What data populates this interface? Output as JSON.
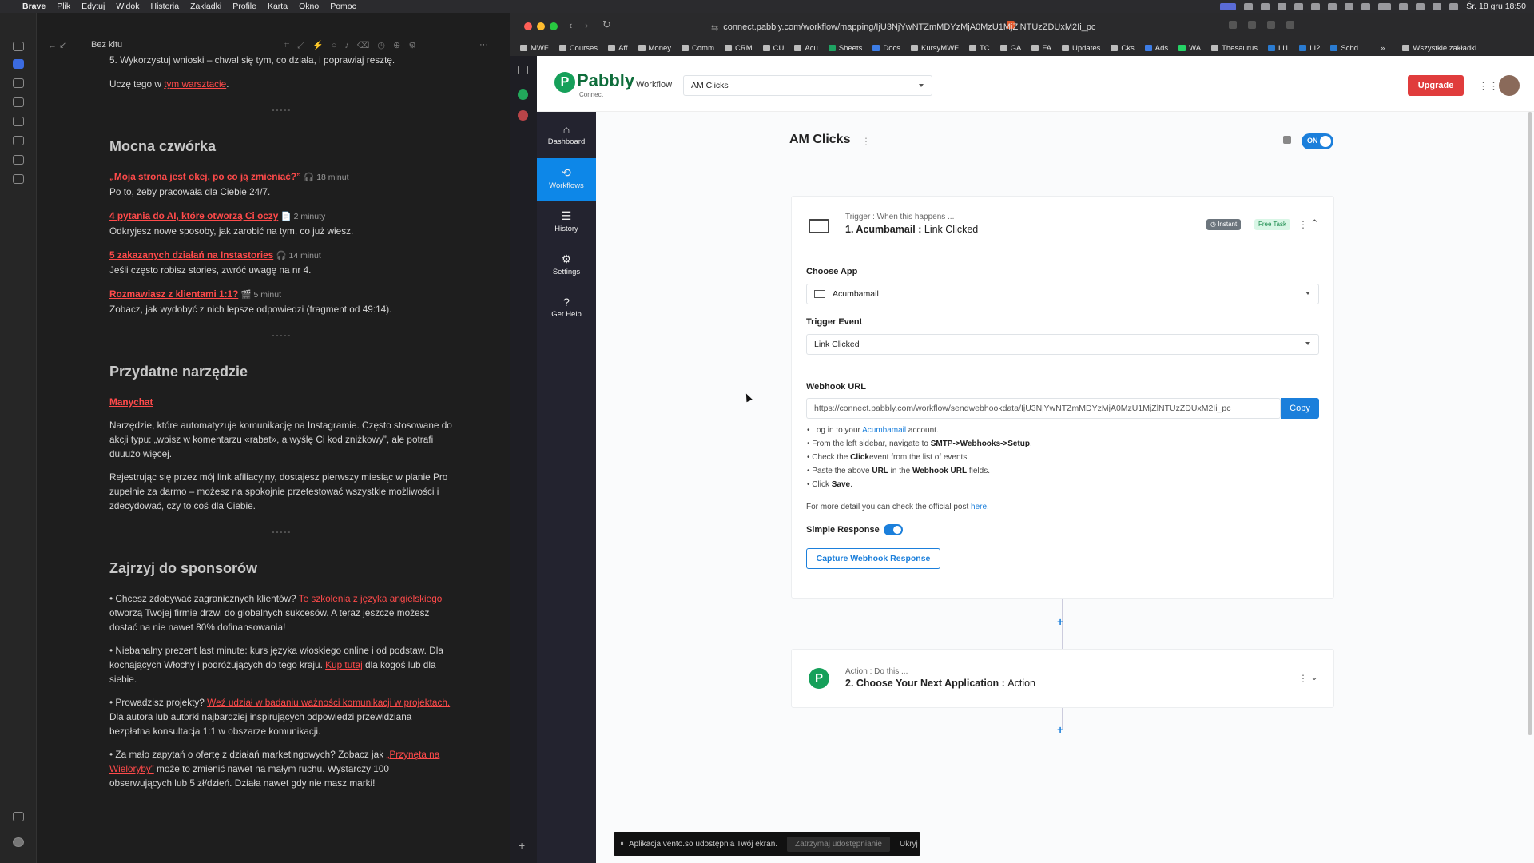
{
  "menubar": {
    "app": "Brave",
    "menus": [
      "Plik",
      "Edytuj",
      "Widok",
      "Historia",
      "Zakładki",
      "Profile",
      "Karta",
      "Okno",
      "Pomoc"
    ],
    "datetime": "Śr. 18 gru  18:50"
  },
  "obsidian": {
    "doc_title": "Bez kitu",
    "top_line": "5. Wykorzystuj wnioski – chwal się tym, co działa, i poprawiaj resztę.",
    "learn_prefix": "Uczę tego w ",
    "learn_link": "tym warsztacie",
    "learn_suffix": ".",
    "sep": "-----",
    "h_four": "Mocna czwórka",
    "items": [
      {
        "link": "„Moja strona jest okej, po co ją zmieniać?”",
        "meta": "🎧 18 minut",
        "desc": "Po to, żeby pracowała dla Ciebie 24/7."
      },
      {
        "link": "4 pytania do AI, które otworzą Ci oczy",
        "meta": "📄 2 minuty",
        "desc": "Odkryjesz nowe sposoby, jak zarobić na tym, co już wiesz."
      },
      {
        "link": "5 zakazanych działań na Instastories",
        "meta": "🎧 14 minut",
        "desc": "Jeśli często robisz stories, zwróć uwagę na nr 4."
      },
      {
        "link": "Rozmawiasz z klientami 1:1?",
        "meta": "🎬 5 minut",
        "desc": "Zobacz, jak wydobyć z nich lepsze odpowiedzi (fragment od 49:14)."
      }
    ],
    "h_tool": "Przydatne narzędzie",
    "tool_link": "Manychat",
    "tool_p1": "Narzędzie, które automatyzuje komunikację na Instagramie. Często stosowane do akcji typu: „wpisz w komentarzu «rabat», a wyślę Ci kod zniżkowy”, ale potrafi duuużo więcej.",
    "tool_p2": "Rejestrując się przez mój link afiliacyjny, dostajesz pierwszy miesiąc w planie Pro zupełnie za darmo – możesz na spokojnie przetestować wszystkie możliwości i zdecydować, czy to coś dla Ciebie.",
    "h_sponsors": "Zajrzyj do sponsorów",
    "s1_pre": "• Chcesz zdobywać zagranicznych klientów? ",
    "s1_link": "Te szkolenia z języka angielskiego",
    "s1_post": " otworzą Twojej firmie drzwi do globalnych sukcesów. A teraz jeszcze możesz dostać na nie nawet 80% dofinansowania!",
    "s2_pre": "• Niebanalny prezent last minute: kurs języka włoskiego online i od podstaw. Dla kochających Włochy i podróżujących do tego kraju. ",
    "s2_link": "Kup tutaj",
    "s2_post": " dla kogoś lub dla siebie.",
    "s3_pre": "• Prowadzisz projekty? ",
    "s3_link": "Weź udział w badaniu ważności komunikacji w projektach.",
    "s3_post": " Dla autora lub autorki najbardziej inspirujących odpowiedzi przewidziana bezpłatna konsultacja 1:1 w obszarze komunikacji.",
    "s4_pre": "• Za mało zapytań o ofertę z działań marketingowych? Zobacz jak ",
    "s4_link": "„Przynęta na Wieloryby”",
    "s4_post": " może to zmienić nawet na małym ruchu. Wystarczy 100 obserwujących lub 5 zł/dzień. Działa nawet gdy nie masz marki!"
  },
  "browser": {
    "url": "connect.pabbly.com/workflow/mapping/IjU3NjYwNTZmMDYzMjA0MzU1MjZlNTUzZDUxM2Ii_pc",
    "bookmarks": [
      "MWF",
      "Courses",
      "Aff",
      "Money",
      "Comm",
      "CRM",
      "CU",
      "Acu",
      "Sheets",
      "Docs",
      "KursyMWF",
      "TC",
      "GA",
      "FA",
      "Updates",
      "Cks",
      "Ads",
      "WA",
      "Thesaurus",
      "LI1",
      "LI2",
      "Schd"
    ],
    "bookmarks_more": "»",
    "all_bookmarks": "Wszystkie zakładki"
  },
  "pabbly": {
    "logo": "Pabbly",
    "logo_sub": "Connect",
    "workflow_label": "Workflow",
    "workflow_name": "AM Clicks",
    "upgrade": "Upgrade",
    "nav": [
      {
        "icon": "home-icon",
        "glyph": "⌂",
        "label": "Dashboard"
      },
      {
        "icon": "workflows-icon",
        "glyph": "⟲",
        "label": "Workflows"
      },
      {
        "icon": "history-icon",
        "glyph": "☰",
        "label": "History"
      },
      {
        "icon": "gear-icon",
        "glyph": "⚙",
        "label": "Settings"
      },
      {
        "icon": "help-icon",
        "glyph": "?",
        "label": "Get Help"
      }
    ],
    "title": "AM Clicks",
    "toggle_label": "ON",
    "trigger": {
      "subtitle": "Trigger : When this happens ...",
      "name": "1. Acumbamail : ",
      "event_label": "Link Clicked",
      "badge_instant": "Instant",
      "badge_free": "Free Task",
      "choose_app_label": "Choose App",
      "choose_app_value": "Acumbamail",
      "trigger_event_label": "Trigger Event",
      "trigger_event_value": "Link Clicked",
      "webhook_label": "Webhook URL",
      "webhook_url": "https://connect.pabbly.com/workflow/sendwebhookdata/IjU3NjYwNTZmMDYzMjA0MzU1MjZlNTUzZDUxM2Ii_pc",
      "copy": "Copy",
      "steps": [
        [
          "Log in to your ",
          "Acumbamail",
          " account."
        ],
        [
          "From the left sidebar, navigate to ",
          "SMTP->Webhooks->Setup",
          "."
        ],
        [
          "Check the ",
          "Click",
          "event from the list of events."
        ],
        [
          "Paste the above ",
          "URL",
          " in the ",
          "Webhook URL",
          " fields."
        ],
        [
          "Click ",
          "Save",
          "."
        ]
      ],
      "more_pre": "For more detail you can check the official post ",
      "more_link": "here.",
      "simple_response": "Simple Response",
      "capture_btn": "Capture Webhook Response"
    },
    "action": {
      "subtitle": "Action : Do this ...",
      "name": "2. Choose Your Next Application : ",
      "type": "Action"
    }
  },
  "share_bar": {
    "text": "Aplikacja vento.so udostępnia Twój ekran.",
    "stop": "Zatrzymaj udostępnianie",
    "hide": "Ukryj"
  }
}
